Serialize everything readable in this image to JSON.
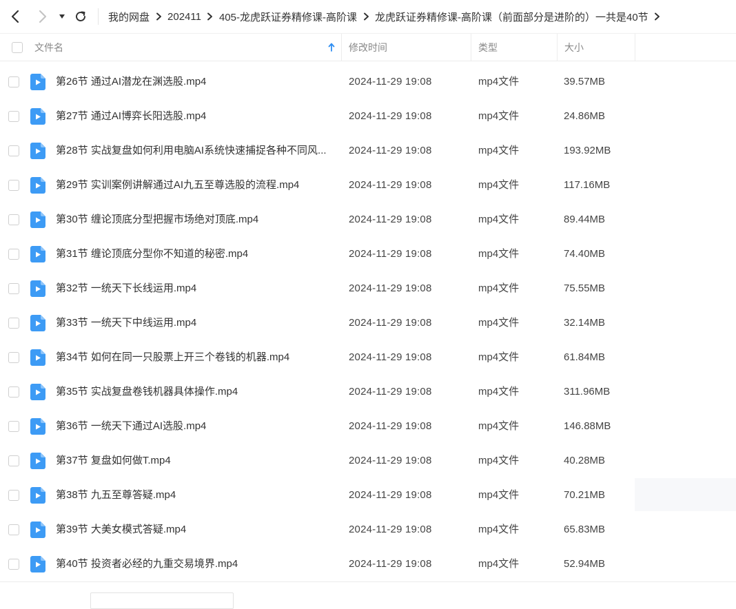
{
  "breadcrumb": [
    "我的网盘",
    "202411",
    "405-龙虎跃证券精修课-高阶课",
    "龙虎跃证券精修课-高阶课（前面部分是进阶的）一共是40节"
  ],
  "columns": {
    "name": "文件名",
    "modified": "修改时间",
    "type": "类型",
    "size": "大小"
  },
  "icons": {
    "back": "chevron-left-icon",
    "forward": "chevron-right-icon",
    "dropdown": "caret-down-icon",
    "refresh": "refresh-icon",
    "sort": "arrow-up-icon",
    "file": "video-file-icon"
  },
  "colors": {
    "accent": "#2f8ef2",
    "file_icon": "#3d9bf5"
  },
  "files": [
    {
      "name": "第26节 通过AI潜龙在渊选股.mp4",
      "modified": "2024-11-29 19:08",
      "type": "mp4文件",
      "size": "39.57MB"
    },
    {
      "name": "第27节 通过AI博弈长阳选股.mp4",
      "modified": "2024-11-29 19:08",
      "type": "mp4文件",
      "size": "24.86MB"
    },
    {
      "name": "第28节 实战复盘如何利用电脑AI系统快速捕捉各种不同风...",
      "modified": "2024-11-29 19:08",
      "type": "mp4文件",
      "size": "193.92MB"
    },
    {
      "name": "第29节 实训案例讲解通过AI九五至尊选股的流程.mp4",
      "modified": "2024-11-29 19:08",
      "type": "mp4文件",
      "size": "117.16MB"
    },
    {
      "name": "第30节 缠论顶底分型把握市场绝对顶底.mp4",
      "modified": "2024-11-29 19:08",
      "type": "mp4文件",
      "size": "89.44MB"
    },
    {
      "name": "第31节 缠论顶底分型你不知道的秘密.mp4",
      "modified": "2024-11-29 19:08",
      "type": "mp4文件",
      "size": "74.40MB"
    },
    {
      "name": "第32节 一统天下长线运用.mp4",
      "modified": "2024-11-29 19:08",
      "type": "mp4文件",
      "size": "75.55MB"
    },
    {
      "name": "第33节 一统天下中线运用.mp4",
      "modified": "2024-11-29 19:08",
      "type": "mp4文件",
      "size": "32.14MB"
    },
    {
      "name": "第34节 如何在同一只股票上开三个卷钱的机器.mp4",
      "modified": "2024-11-29 19:08",
      "type": "mp4文件",
      "size": "61.84MB"
    },
    {
      "name": "第35节 实战复盘卷钱机器具体操作.mp4",
      "modified": "2024-11-29 19:08",
      "type": "mp4文件",
      "size": "311.96MB"
    },
    {
      "name": "第36节 一统天下通过AI选股.mp4",
      "modified": "2024-11-29 19:08",
      "type": "mp4文件",
      "size": "146.88MB"
    },
    {
      "name": "第37节 复盘如何做T.mp4",
      "modified": "2024-11-29 19:08",
      "type": "mp4文件",
      "size": "40.28MB"
    },
    {
      "name": "第38节 九五至尊答疑.mp4",
      "modified": "2024-11-29 19:08",
      "type": "mp4文件",
      "size": "70.21MB"
    },
    {
      "name": "第39节 大美女模式答疑.mp4",
      "modified": "2024-11-29 19:08",
      "type": "mp4文件",
      "size": "65.83MB"
    },
    {
      "name": "第40节 投资者必经的九重交易境界.mp4",
      "modified": "2024-11-29 19:08",
      "type": "mp4文件",
      "size": "52.94MB"
    }
  ]
}
